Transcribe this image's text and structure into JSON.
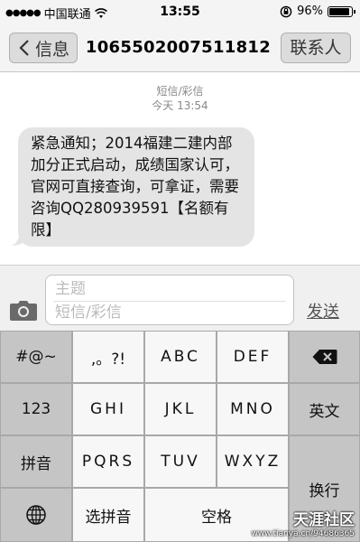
{
  "status_bar": {
    "signal": "●●●●●",
    "carrier": "中国联通",
    "time": "13:55",
    "battery_text": "96%",
    "battery_level": 0.96
  },
  "nav": {
    "back_label": "信息",
    "title": "1065502007511812",
    "contact_label": "联系人"
  },
  "thread": {
    "type_label": "短信/彩信",
    "timestamp": "今天 13:54",
    "message": "紧急通知；2014福建二建内部加分正式启动，成绩国家认可，官网可直接查询，可拿证，需要咨询QQ280939591【名额有限】"
  },
  "compose": {
    "subject_placeholder": "主题",
    "message_placeholder": "短信/彩信",
    "send_label": "发送"
  },
  "keyboard": {
    "symbols": "#@~",
    "punct": ",。?!",
    "abc": "ABC",
    "def": "DEF",
    "num": "123",
    "ghi": "GHI",
    "jkl": "JKL",
    "mno": "MNO",
    "english": "英文",
    "pinyin": "拼音",
    "pqrs": "PQRS",
    "tuv": "TUV",
    "wxyz": "WXYZ",
    "return": "换行",
    "select_pinyin": "选拼音",
    "space": "空格"
  },
  "watermark": {
    "site": "天涯社区",
    "url": "www.tianya.cn/94686365"
  }
}
